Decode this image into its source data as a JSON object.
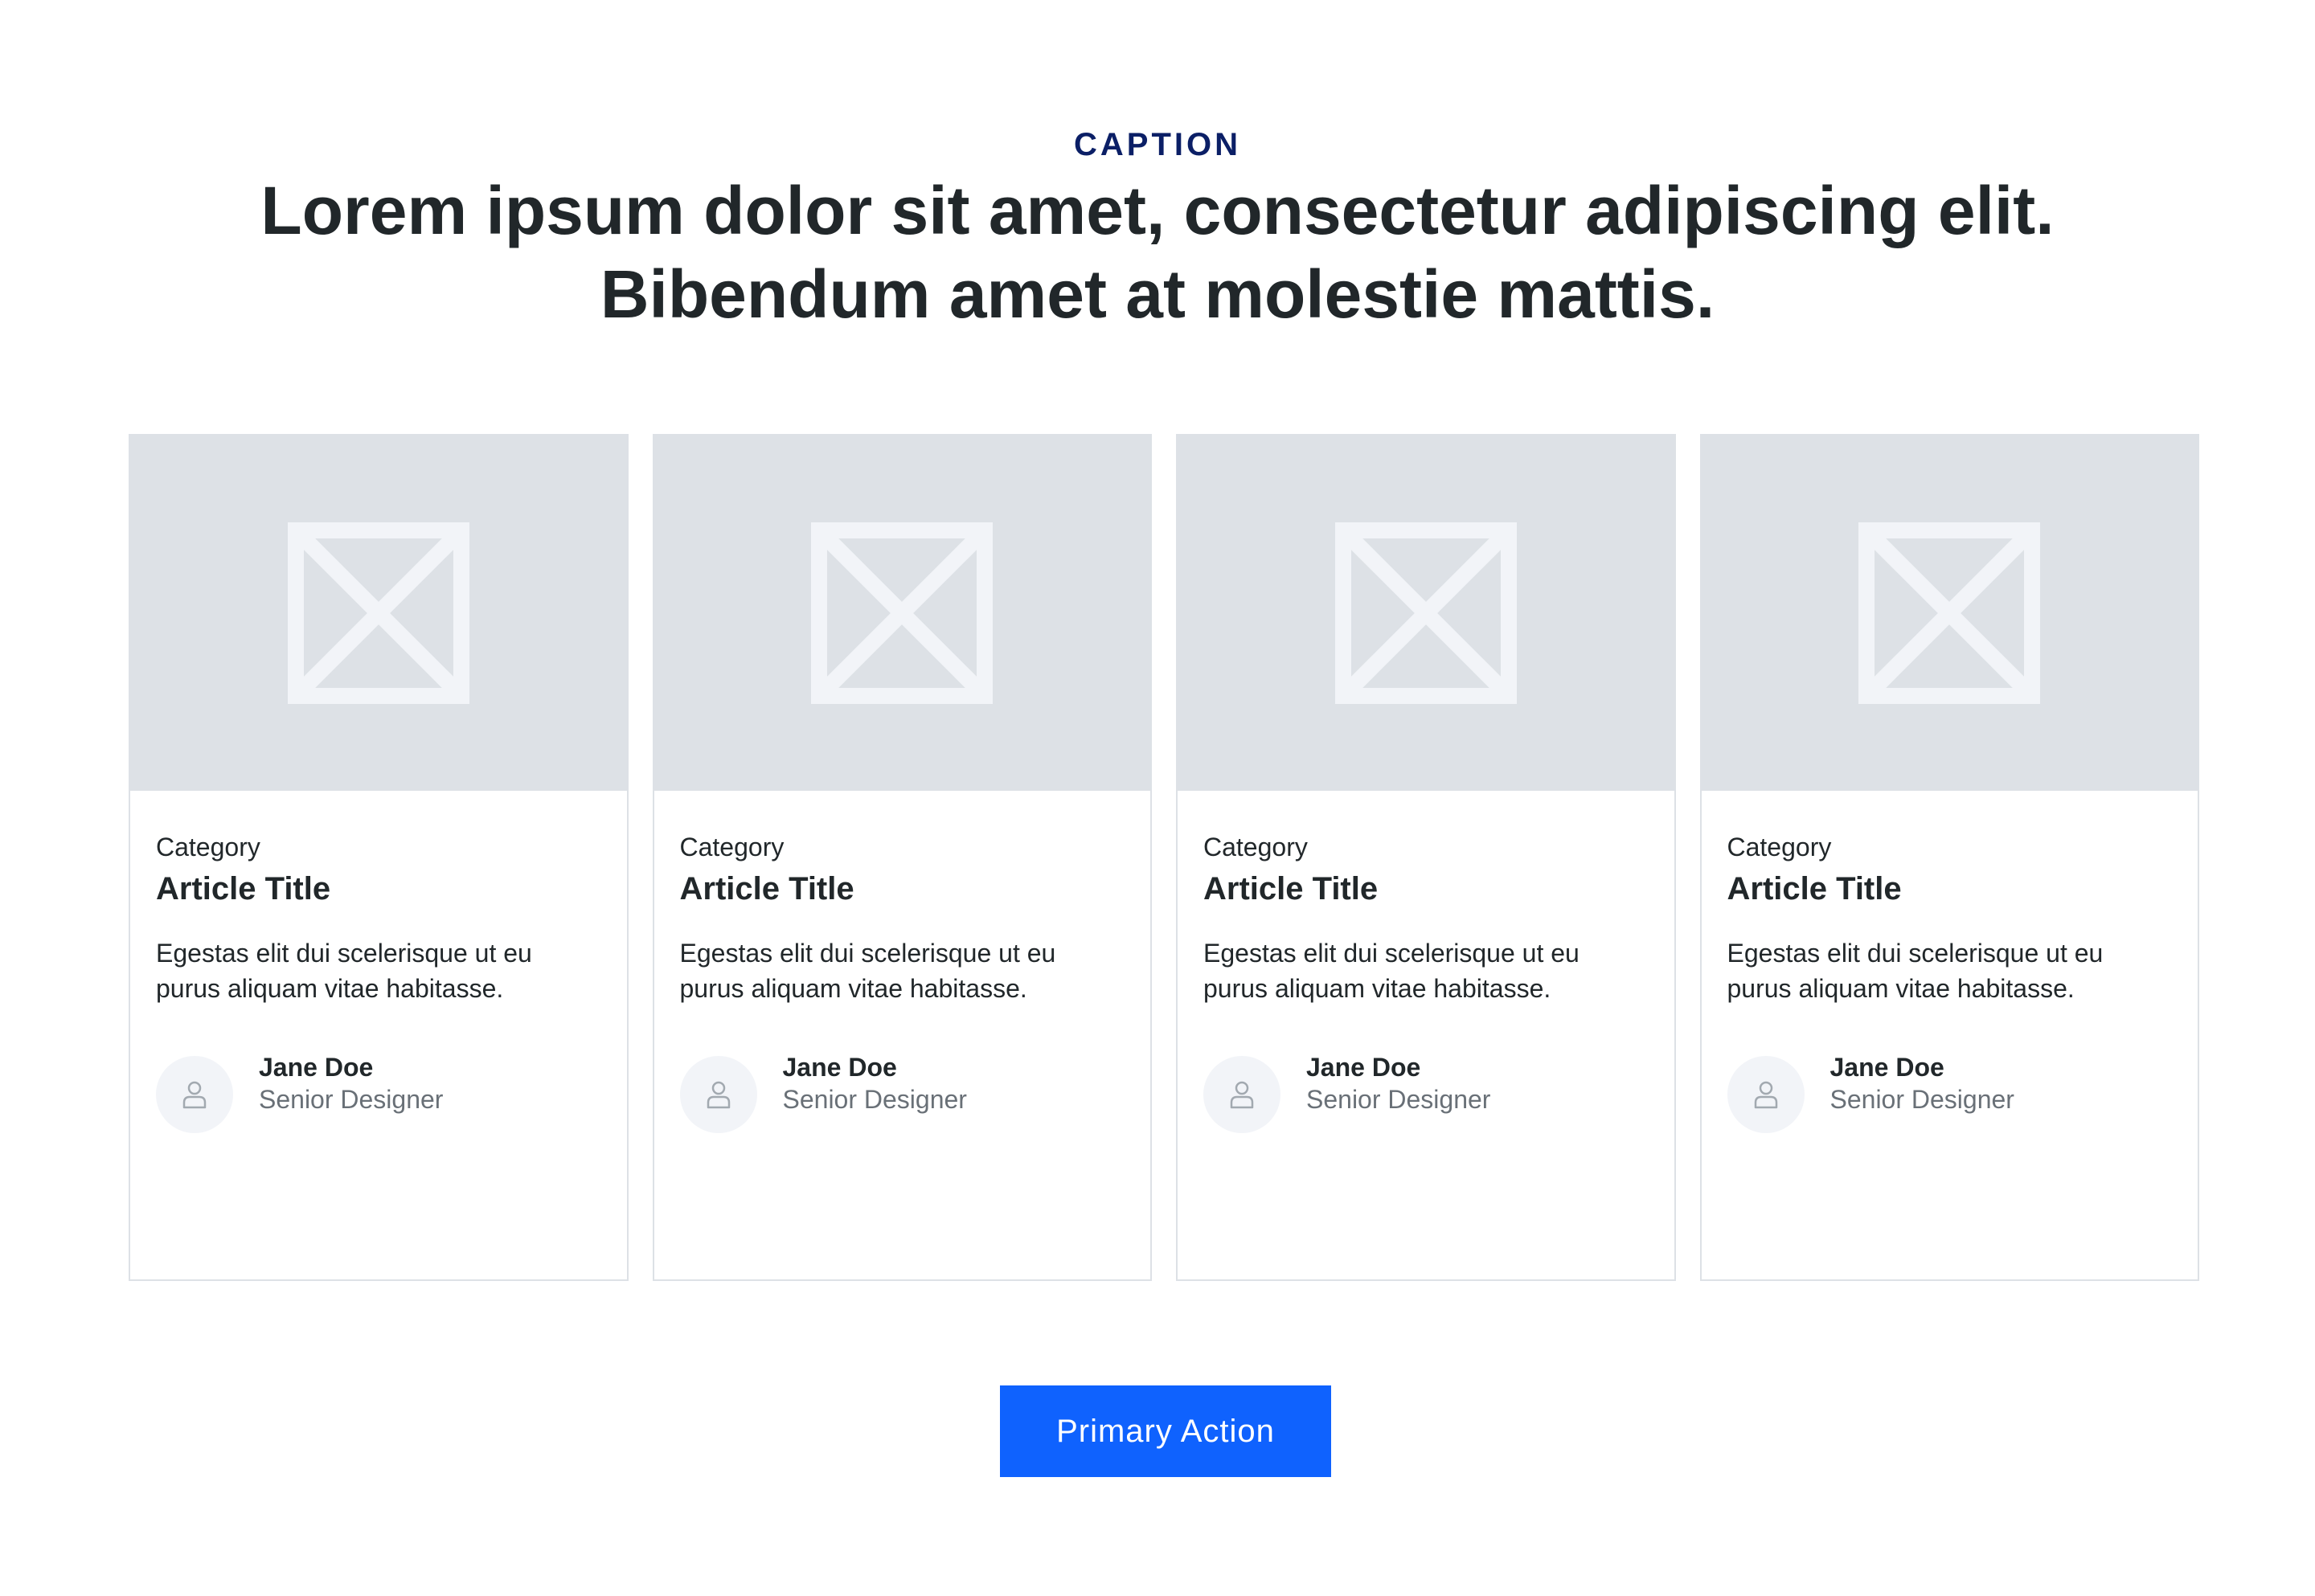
{
  "header": {
    "caption": "CAPTION",
    "headline": "Lorem ipsum dolor sit amet, consectetur adipiscing elit. Bibendum amet at molestie mattis."
  },
  "colors": {
    "caption": "#0b1f66",
    "text": "#21272a",
    "muted": "#697077",
    "placeholder_bg": "#dde1e6",
    "placeholder_icon": "#f2f4f8",
    "primary": "#0f62fe"
  },
  "cards": [
    {
      "image_icon": "image-placeholder-icon",
      "category": "Category",
      "title": "Article Title",
      "excerpt": "Egestas elit dui scelerisque ut eu purus aliquam vitae habitasse.",
      "author": {
        "avatar_icon": "user-icon",
        "name": "Jane Doe",
        "role": "Senior Designer"
      }
    },
    {
      "image_icon": "image-placeholder-icon",
      "category": "Category",
      "title": "Article Title",
      "excerpt": "Egestas elit dui scelerisque ut eu purus aliquam vitae habitasse.",
      "author": {
        "avatar_icon": "user-icon",
        "name": "Jane Doe",
        "role": "Senior Designer"
      }
    },
    {
      "image_icon": "image-placeholder-icon",
      "category": "Category",
      "title": "Article Title",
      "excerpt": "Egestas elit dui scelerisque ut eu purus aliquam vitae habitasse.",
      "author": {
        "avatar_icon": "user-icon",
        "name": "Jane Doe",
        "role": "Senior Designer"
      }
    },
    {
      "image_icon": "image-placeholder-icon",
      "category": "Category",
      "title": "Article Title",
      "excerpt": "Egestas elit dui scelerisque ut eu purus aliquam vitae habitasse.",
      "author": {
        "avatar_icon": "user-icon",
        "name": "Jane Doe",
        "role": "Senior Designer"
      }
    }
  ],
  "actions": {
    "primary_label": "Primary Action"
  }
}
